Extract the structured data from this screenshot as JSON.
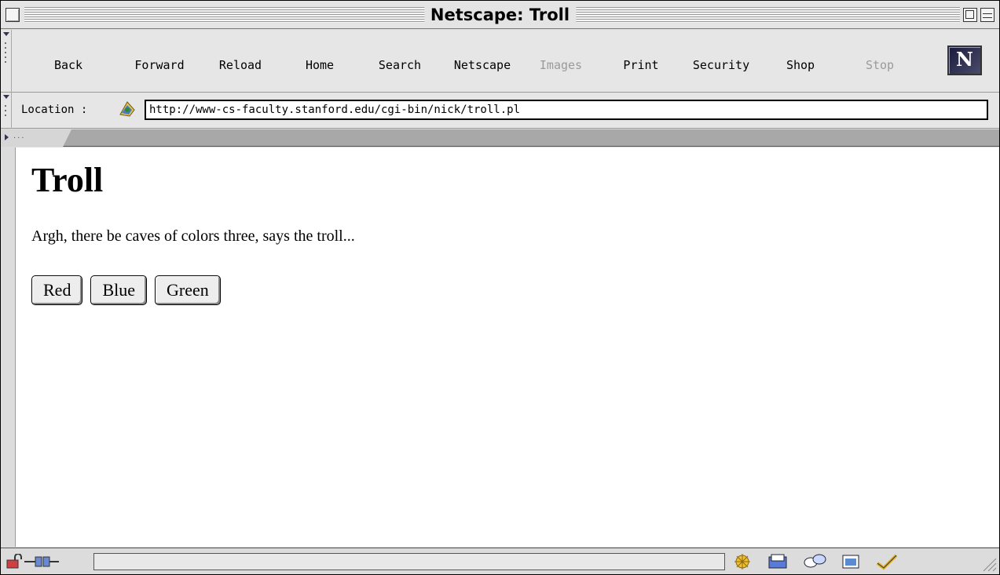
{
  "window": {
    "title": "Netscape: Troll"
  },
  "toolbar": {
    "buttons": [
      {
        "label": "Back",
        "enabled": true
      },
      {
        "label": "Forward",
        "enabled": true
      },
      {
        "label": "Reload",
        "enabled": true
      },
      {
        "label": "Home",
        "enabled": true
      },
      {
        "label": "Search",
        "enabled": true
      },
      {
        "label": "Netscape",
        "enabled": true
      },
      {
        "label": "Images",
        "enabled": false
      },
      {
        "label": "Print",
        "enabled": true
      },
      {
        "label": "Security",
        "enabled": true
      },
      {
        "label": "Shop",
        "enabled": true
      },
      {
        "label": "Stop",
        "enabled": false
      }
    ],
    "logo_letter": "N"
  },
  "location": {
    "label": "Location :",
    "url": "http://www-cs-faculty.stanford.edu/cgi-bin/nick/troll.pl",
    "icon": "bookmark-icon"
  },
  "page": {
    "heading": "Troll",
    "text": "Argh, there be caves of colors three, says the troll...",
    "buttons": [
      "Red",
      "Blue",
      "Green"
    ]
  },
  "status": {
    "text": "",
    "icons": [
      "navigator-icon",
      "mail-icon",
      "discussions-icon",
      "composer-icon",
      "check-icon"
    ]
  },
  "colors": {
    "disabled_text": "#9a9a9a",
    "toolbar_bg": "#e6e6e6",
    "content_bg": "#ffffff"
  }
}
